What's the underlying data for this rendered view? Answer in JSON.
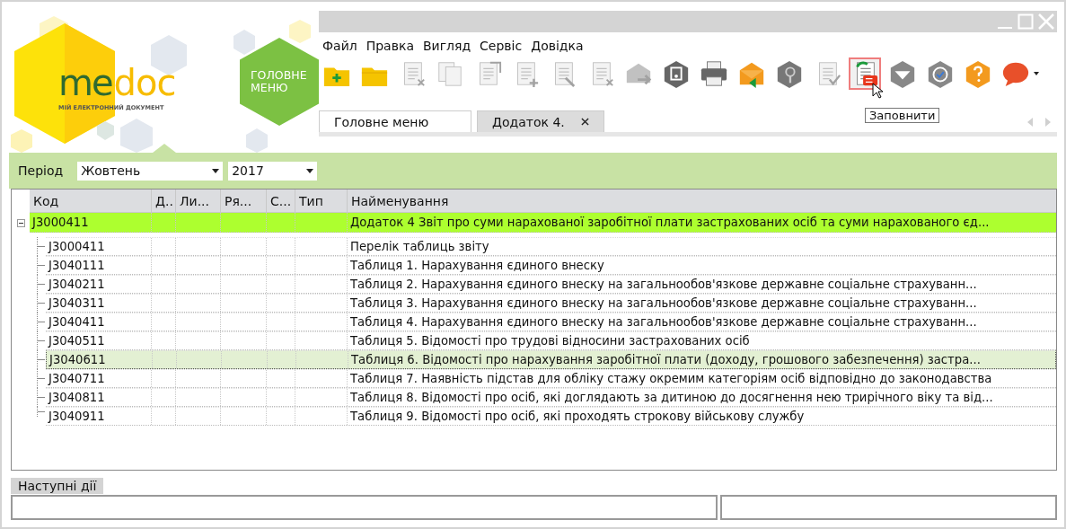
{
  "logo": {
    "word_1": "me",
    "word_2": "doc",
    "tagline": "МІЙ ЕЛЕКТРОННИЙ ДОКУМЕНТ"
  },
  "main_menu_button": {
    "label": "ГОЛОВНЕ МЕНЮ"
  },
  "menu": [
    "Файл",
    "Правка",
    "Вигляд",
    "Сервіс",
    "Довідка"
  ],
  "toolbar": [
    {
      "kind": "folder-new",
      "disabled": false,
      "hovered": false
    },
    {
      "kind": "folder",
      "disabled": false,
      "hovered": false
    },
    {
      "kind": "doc-delete",
      "disabled": true,
      "hovered": false
    },
    {
      "kind": "copy",
      "disabled": true,
      "hovered": false
    },
    {
      "kind": "doc-edit",
      "disabled": true,
      "hovered": false
    },
    {
      "kind": "doc-add",
      "disabled": true,
      "hovered": false
    },
    {
      "kind": "doc-pen",
      "disabled": true,
      "hovered": false
    },
    {
      "kind": "doc-remove",
      "disabled": true,
      "hovered": false
    },
    {
      "kind": "mail-send",
      "disabled": true,
      "hovered": false
    },
    {
      "kind": "hex-safe",
      "disabled": false,
      "hovered": false
    },
    {
      "kind": "printer",
      "disabled": false,
      "hovered": false
    },
    {
      "kind": "mail-orange",
      "disabled": false,
      "hovered": false
    },
    {
      "kind": "hex-search",
      "disabled": false,
      "hovered": false
    },
    {
      "kind": "doc-check",
      "disabled": true,
      "hovered": false
    },
    {
      "kind": "fill",
      "disabled": false,
      "hovered": true
    },
    {
      "kind": "hex-inbox",
      "disabled": false,
      "hovered": false
    },
    {
      "kind": "hex-sync",
      "disabled": false,
      "hovered": false
    },
    {
      "kind": "help",
      "disabled": false,
      "hovered": false
    },
    {
      "kind": "chat",
      "disabled": false,
      "hovered": false
    }
  ],
  "tooltip": "Заповнити",
  "tabs": [
    {
      "label": "Головне меню",
      "selected": false,
      "closable": false
    },
    {
      "label": "Додаток 4.",
      "selected": true,
      "closable": true
    }
  ],
  "period": {
    "label": "Період",
    "month": "Жовтень",
    "year": "2017"
  },
  "table": {
    "columns": [
      "Код",
      "Д..",
      "Ли...",
      "Ря...",
      "С...",
      "Тип",
      "Найменування"
    ],
    "rows": [
      {
        "code": "J3000411",
        "name": "Додаток 4 Звіт про суми нарахованої заробітної плати застрахованих осіб та суми нарахованого єд...",
        "expanded": true,
        "highlighted": true,
        "children": [
          {
            "code": "J3000411",
            "name": "Перелік таблиць звіту",
            "selected": false
          },
          {
            "code": "J3040111",
            "name": "Таблиця 1. Нарахування єдиного внеску",
            "selected": false
          },
          {
            "code": "J3040211",
            "name": "Таблиця 2. Нарахування єдиного внеску на загальнообов'язкове державне соціальне страхуванн...",
            "selected": false
          },
          {
            "code": "J3040311",
            "name": "Таблиця 3. Нарахування єдиного внеску на загальнообов'язкове державне соціальне страхуванн...",
            "selected": false
          },
          {
            "code": "J3040411",
            "name": "Таблиця 4. Нарахування єдиного внеску на загальнообов'язкове державне соціальне страхуванн...",
            "selected": false
          },
          {
            "code": "J3040511",
            "name": "Таблиця 5. Відомості про трудові відносини застрахованих осіб",
            "selected": false
          },
          {
            "code": "J3040611",
            "name": "Таблиця 6. Відомості про нарахування заробітної плати (доходу, грошового забезпечення) застра...",
            "selected": true
          },
          {
            "code": "J3040711",
            "name": "Таблиця 7. Наявність підстав для обліку стажу окремим категоріям осіб відповідно до законодавства",
            "selected": false
          },
          {
            "code": "J3040811",
            "name": "Таблиця 8. Відомості про осіб, які доглядають за дитиною до досягнення нею трирічного віку та від...",
            "selected": false
          },
          {
            "code": "J3040911",
            "name": "Таблиця 9. Відомості про осіб, які проходять строкову військову службу",
            "selected": false
          }
        ]
      }
    ]
  },
  "next_actions": {
    "label": "Наступні дії"
  }
}
